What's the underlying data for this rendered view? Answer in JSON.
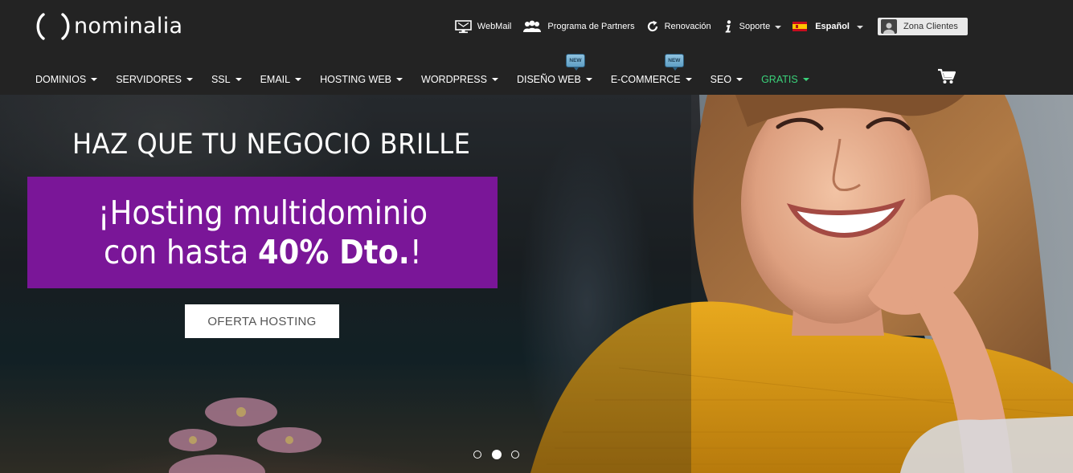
{
  "brand": {
    "name": "nominalia"
  },
  "topbar": {
    "webmail": "WebMail",
    "partners": "Programa de Partners",
    "renovacion": "Renovación",
    "soporte": "Soporte",
    "language": "Español",
    "zona_clientes": "Zona Clientes"
  },
  "nav": {
    "items": [
      {
        "label": "DOMINIOS"
      },
      {
        "label": "SERVIDORES"
      },
      {
        "label": "SSL"
      },
      {
        "label": "EMAIL"
      },
      {
        "label": "HOSTING WEB"
      },
      {
        "label": "WORDPRESS"
      },
      {
        "label": "DISEÑO WEB",
        "badge": "NEW"
      },
      {
        "label": "E-COMMERCE",
        "badge": "NEW"
      },
      {
        "label": "SEO"
      },
      {
        "label": "GRATIS"
      }
    ]
  },
  "hero": {
    "title": "HAZ QUE TU NEGOCIO BRILLE",
    "promo_line1": "¡Hosting multidominio",
    "promo_line2_prefix": "con hasta ",
    "promo_line2_bold": "40% Dto.",
    "promo_line2_suffix": "!",
    "cta": "OFERTA HOSTING",
    "slides_total": 3,
    "active_slide": 2
  },
  "colors": {
    "header_bg": "#232323",
    "promo_bg": "#7a1698",
    "gratis_green": "#3ad27a",
    "new_badge": "#7fb4d4"
  },
  "icons": [
    "monitor-icon",
    "users-icon",
    "refresh-icon",
    "info-icon",
    "spain-flag-icon",
    "user-icon",
    "cart-icon"
  ]
}
